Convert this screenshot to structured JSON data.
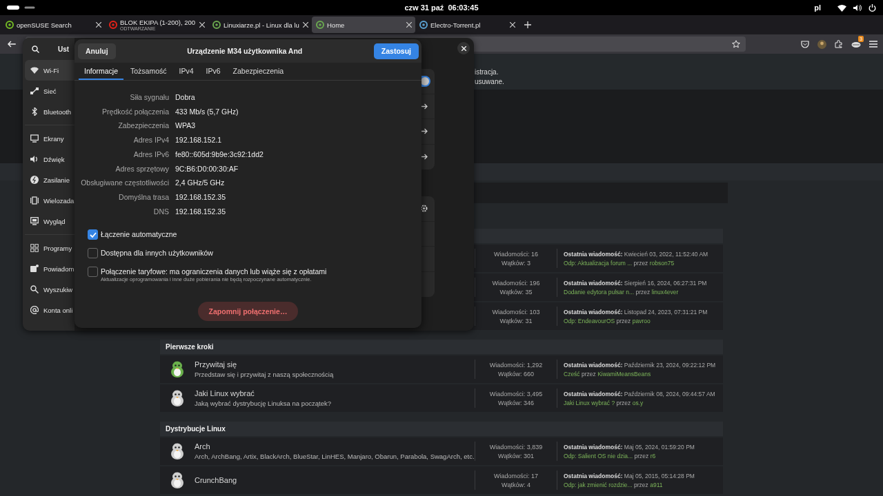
{
  "top_bar": {
    "clock": "czw 31 paź  06:03:45",
    "keyboard_layout": "pl"
  },
  "browser": {
    "tabs": [
      {
        "title": "openSUSE Search",
        "selected": false,
        "color": "#73ba25"
      },
      {
        "title": "BLOK EKIPA (1-200), 200",
        "subtitle": "ODTWARZANIE",
        "selected": false,
        "color": "#e62117"
      },
      {
        "title": "Linuxiarze.pl - Linux dla lu",
        "selected": false,
        "color": "#6aa84f"
      },
      {
        "title": "Home",
        "selected": true,
        "color": "#6aa84f"
      },
      {
        "title": "Electro-Torrent.pl",
        "selected": false,
        "color": "#5aa0d0"
      }
    ],
    "extension_badge": "3"
  },
  "page": {
    "notice_lines": [
      "istracja.",
      "usuwane."
    ],
    "sections": [
      {
        "rows": [
          {
            "messages": "Wiadomości: 16",
            "topics": "Wątków: 3",
            "last_post": "**Ostatnia wiadomość:** Kwiecień 03, 2022, 11:52:40 AM",
            "post_link": "Odp: Aktualizacja forum ...",
            "by": "przez",
            "user": "robson75"
          },
          {
            "messages": "Wiadomości: 196",
            "topics": "Wątków: 35",
            "last_post": "**Ostatnia wiadomość:** Sierpień 16, 2024, 06:27:31 PM",
            "post_link": "Dodanie edytora pulsar n...",
            "by": "przez",
            "user": "linux4ever"
          },
          {
            "messages": "Wiadomości: 103",
            "topics": "Wątków: 31",
            "last_post": "**Ostatnia wiadomość:** Listopad 24, 2023, 07:31:21 PM",
            "post_link": "Odp: EndeavourOS",
            "by": "przez",
            "user": "pavroo"
          }
        ]
      },
      {
        "title": "Pierwsze kroki",
        "rows": [
          {
            "color": "#6ab04c",
            "name": "Przywitaj się",
            "description": "Przedstaw się i przywitaj z naszą społecznością",
            "messages": "Wiadomości: 1,292",
            "topics": "Wątków: 660",
            "last_post": "**Ostatnia wiadomość:** Październik 23, 2024, 09:22:12 PM",
            "post_link": "Cześć",
            "by": "przez",
            "user": "KiwamiMeansBeans"
          },
          {
            "color": "#cfcfcf",
            "name": "Jaki Linux wybrać",
            "description": "Jaką wybrać dystrybucję Linuksa na początek?",
            "messages": "Wiadomości: 3,495",
            "topics": "Wątków: 346",
            "last_post": "**Ostatnia wiadomość:** Październik 08, 2024, 09:44:57 AM",
            "post_link": "Jaki Linux wybrać ?",
            "by": "przez",
            "user": "os.y"
          }
        ]
      },
      {
        "title": "Dystrybucje Linux",
        "rows": [
          {
            "color": "#cfcfcf",
            "name": "Arch",
            "description": "Arch, ArchBang, Artix, BlackArch, BlueStar, LinHES, Manjaro, Obarun, Parabola, SwagArch, etc.",
            "messages": "Wiadomości: 3,839",
            "topics": "Wątków: 301",
            "last_post": "**Ostatnia wiadomość:** Maj 05, 2024, 01:59:20 PM",
            "post_link": "Odp: Salient OS nie dzia...",
            "by": "przez",
            "user": "r6"
          },
          {
            "color": "#cfcfcf",
            "name": "CrunchBang",
            "messages": "Wiadomości: 17",
            "topics": "Wątków: 4",
            "last_post": "**Ostatnia wiadomość:** Maj 05, 2015, 05:14:28 PM",
            "post_link": "Odp: jak zmienić rozdzie...",
            "by": "przez",
            "user": "a911"
          }
        ]
      }
    ]
  },
  "settings": {
    "title": "Ust",
    "sidebar": [
      {
        "items": [
          {
            "label": "Wi-Fi",
            "selected": true
          },
          {
            "label": "Sieć",
            "selected": false
          },
          {
            "label": "Bluetooth",
            "selected": false
          }
        ]
      },
      {
        "items": [
          {
            "label": "Ekrany",
            "selected": false
          },
          {
            "label": "Dźwięk",
            "selected": false
          },
          {
            "label": "Zasilanie",
            "selected": false
          },
          {
            "label": "Wielozada",
            "selected": false
          },
          {
            "label": "Wygląd",
            "selected": false
          }
        ]
      },
      {
        "items": [
          {
            "label": "Programy",
            "selected": false
          },
          {
            "label": "Powiadom",
            "selected": false
          },
          {
            "label": "Wyszukiw",
            "selected": false
          },
          {
            "label": "Konta onli",
            "selected": false
          }
        ]
      }
    ],
    "cards": [
      {
        "rows": [
          {
            "kind": "toggle",
            "on": true
          },
          {
            "kind": "link"
          },
          {
            "kind": "link"
          },
          {
            "kind": "link"
          }
        ]
      },
      {
        "rows": [
          {
            "kind": "button"
          },
          {
            "kind": "plain"
          },
          {
            "kind": "plain"
          },
          {
            "kind": "plain"
          }
        ]
      }
    ]
  },
  "dialog": {
    "title": "Urządzenie M34 użytkownika And",
    "cancel": "Anuluj",
    "apply": "Zastosuj",
    "tabs": [
      {
        "label": "Informacje",
        "selected": true
      },
      {
        "label": "Tożsamość",
        "selected": false
      },
      {
        "label": "IPv4",
        "selected": false
      },
      {
        "label": "IPv6",
        "selected": false
      },
      {
        "label": "Zabezpieczenia",
        "selected": false
      }
    ],
    "details": [
      {
        "label": "Siła sygnału",
        "value": "Dobra"
      },
      {
        "label": "Prędkość połączenia",
        "value": "433 Mb/s (5,7 GHz)"
      },
      {
        "label": "Zabezpieczenia",
        "value": "WPA3"
      },
      {
        "label": "Adres IPv4",
        "value": "192.168.152.1"
      },
      {
        "label": "Adres IPv6",
        "value": "fe80::605d:9b9e:3c92:1dd2"
      },
      {
        "label": "Adres sprzętowy",
        "value": "9C:B6:D0:00:30:AF"
      },
      {
        "label": "Obsługiwane częstotliwości",
        "value": "2,4 GHz/5 GHz"
      },
      {
        "label": "Domyślna trasa",
        "value": "192.168.152.35"
      },
      {
        "label": "DNS",
        "value": "192.168.152.35"
      }
    ],
    "options": [
      {
        "label": "Łączenie automatyczne",
        "checked": true
      },
      {
        "label": "Dostępna dla innych użytkowników",
        "checked": false
      },
      {
        "label": "Połączenie taryfowe: ma ograniczenia danych lub wiąże się z opłatami",
        "hint": "Aktualizacje oprogramowania i inne duże pobierania nie będą rozpoczynane automatycznie.",
        "checked": false
      }
    ],
    "forget": "Zapomnij połączenie…"
  }
}
